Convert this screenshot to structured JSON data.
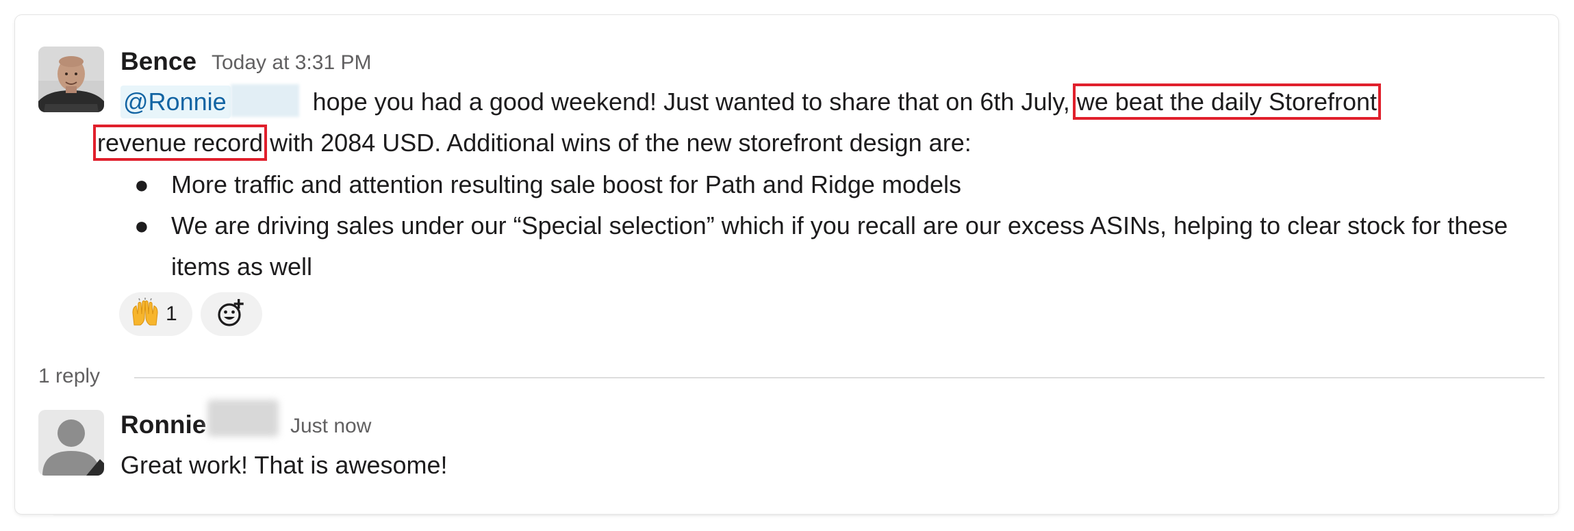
{
  "message": {
    "author": "Bence",
    "timestamp": "Today at 3:31 PM",
    "mention": "@Ronnie",
    "text_before_highlight": " hope you had a good weekend! Just wanted to share that on 6th July,",
    "highlight_part1": "we beat the daily Storefront",
    "highlight_part2": "revenue record",
    "text_after_highlight": " with 2084 USD. Additional wins of the new storefront design are:",
    "bullets": [
      "More traffic and attention resulting sale boost for Path and Ridge models",
      "We are driving sales under our “Special selection” which if you recall are our excess ASINs, helping to clear stock for these items as well"
    ],
    "bullet_glyph": "●",
    "reaction": {
      "emoji": "raising-hands-icon",
      "count": "1"
    }
  },
  "thread": {
    "reply_count_label": "1 reply"
  },
  "reply": {
    "author": "Ronnie",
    "timestamp": "Just now",
    "text": "Great work! That is awesome!"
  },
  "colors": {
    "mention_text": "#1264a3",
    "mention_bg": "#e8f5fa",
    "highlight_border": "#e0202c",
    "secondary_text": "#616061"
  },
  "icons": {
    "author_avatar": "user-photo-avatar",
    "reply_avatar": "default-user-avatar",
    "add_reaction": "add-reaction-icon"
  }
}
